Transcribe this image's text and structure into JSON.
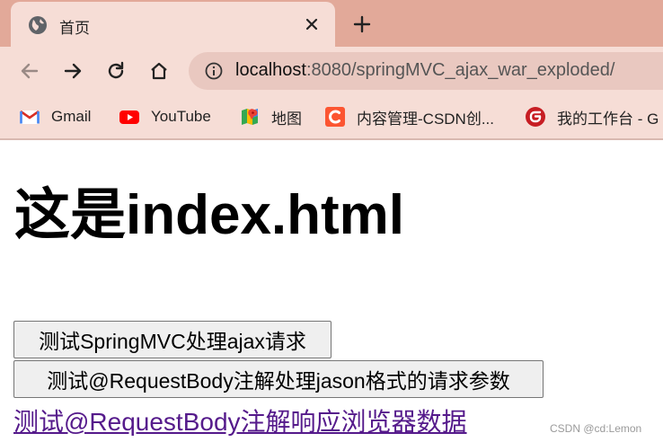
{
  "browser": {
    "tab": {
      "title": "首页",
      "favicon": "globe-icon"
    },
    "new_tab_glyph": "+",
    "omnibox": {
      "host": "localhost",
      "path": ":8080/springMVC_ajax_war_exploded/"
    },
    "bookmarks": [
      {
        "label": "Gmail",
        "icon": "gmail-icon",
        "color": "#d93025"
      },
      {
        "label": "YouTube",
        "icon": "youtube-icon",
        "color": "#ff0000"
      },
      {
        "label": "地图",
        "icon": "maps-icon",
        "color": "#34a853"
      },
      {
        "label": "内容管理-CSDN创...",
        "icon": "csdn-icon",
        "color": "#fc5531"
      },
      {
        "label": "我的工作台 - G",
        "icon": "gitee-icon",
        "color": "#c71d23"
      }
    ]
  },
  "page": {
    "heading": "这是index.html",
    "button_ajax": "测试SpringMVC处理ajax请求",
    "button_json": "测试@RequestBody注解处理jason格式的请求参数",
    "link_response": "测试@RequestBody注解响应浏览器数据",
    "watermark": "CSDN @cd:Lemon"
  }
}
